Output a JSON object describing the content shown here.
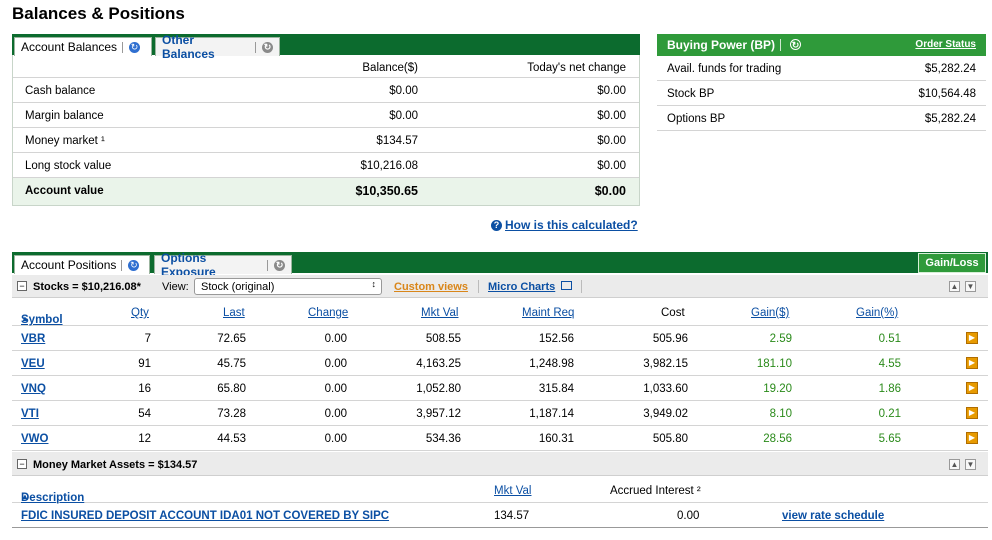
{
  "page_title": "Balances & Positions",
  "balances": {
    "tabs": [
      {
        "label": "Account Balances"
      },
      {
        "label": "Other Balances"
      }
    ],
    "col_headers": [
      "Balance($)",
      "Today's net change"
    ],
    "rows": [
      {
        "label": "Cash balance",
        "balance": "$0.00",
        "change": "$0.00"
      },
      {
        "label": "Margin balance",
        "balance": "$0.00",
        "change": "$0.00"
      },
      {
        "label": "Money market ¹",
        "balance": "$134.57",
        "change": "$0.00"
      },
      {
        "label": "Long stock value",
        "balance": "$10,216.08",
        "change": "$0.00"
      },
      {
        "label": "Account value",
        "balance": "$10,350.65",
        "change": "$0.00"
      }
    ],
    "help_link": "How is this calculated?"
  },
  "buying_power": {
    "title": "Buying Power (BP)",
    "order_status": "Order Status",
    "rows": [
      {
        "label": "Avail. funds for trading",
        "value": "$5,282.24"
      },
      {
        "label": "Stock BP",
        "value": "$10,564.48"
      },
      {
        "label": "Options BP",
        "value": "$5,282.24"
      }
    ]
  },
  "positions": {
    "tabs": [
      {
        "label": "Account Positions"
      },
      {
        "label": "Options Exposure"
      }
    ],
    "gain_loss_button": "Gain/Loss",
    "stocks_group": {
      "label": "Stocks = $10,216.08*",
      "view_label": "View:",
      "view_value": "Stock (original)",
      "custom_views": "Custom views",
      "micro_charts": "Micro Charts"
    },
    "columns": {
      "symbol": "Symbol",
      "qty": "Qty",
      "last": "Last",
      "change": "Change",
      "mkt_val": "Mkt Val",
      "maint_req": "Maint Req",
      "cost": "Cost",
      "gain_d": "Gain($)",
      "gain_p": "Gain(%)"
    },
    "stocks": [
      {
        "symbol": "VBR",
        "qty": "7",
        "last": "72.65",
        "change": "0.00",
        "mkt_val": "508.55",
        "maint_req": "152.56",
        "cost": "505.96",
        "gain_d": "2.59",
        "gain_p": "0.51"
      },
      {
        "symbol": "VEU",
        "qty": "91",
        "last": "45.75",
        "change": "0.00",
        "mkt_val": "4,163.25",
        "maint_req": "1,248.98",
        "cost": "3,982.15",
        "gain_d": "181.10",
        "gain_p": "4.55"
      },
      {
        "symbol": "VNQ",
        "qty": "16",
        "last": "65.80",
        "change": "0.00",
        "mkt_val": "1,052.80",
        "maint_req": "315.84",
        "cost": "1,033.60",
        "gain_d": "19.20",
        "gain_p": "1.86"
      },
      {
        "symbol": "VTI",
        "qty": "54",
        "last": "73.28",
        "change": "0.00",
        "mkt_val": "3,957.12",
        "maint_req": "1,187.14",
        "cost": "3,949.02",
        "gain_d": "8.10",
        "gain_p": "0.21"
      },
      {
        "symbol": "VWO",
        "qty": "12",
        "last": "44.53",
        "change": "0.00",
        "mkt_val": "534.36",
        "maint_req": "160.31",
        "cost": "505.80",
        "gain_d": "28.56",
        "gain_p": "5.65"
      }
    ],
    "mm_group": {
      "label": "Money Market Assets = $134.57",
      "col_description": "Description",
      "col_mkt_val": "Mkt Val",
      "col_accrued": "Accrued Interest ²",
      "row": {
        "description": "FDIC INSURED DEPOSIT ACCOUNT IDA01 NOT COVERED BY SIPC",
        "mkt_val": "134.57",
        "accrued": "0.00",
        "link": "view rate schedule"
      }
    }
  },
  "colors": {
    "dark_green": "#0c6b2e",
    "bp_green": "#2f9a3a",
    "link_blue": "#0b4fa3",
    "gain_green": "#2a8a1a",
    "custom_views_orange": "#d9861a"
  }
}
